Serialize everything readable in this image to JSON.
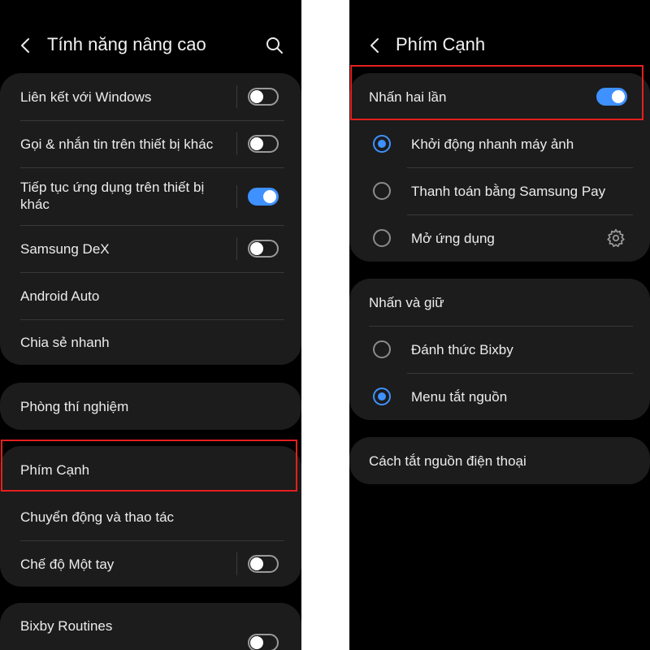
{
  "left": {
    "title": "Tính năng nâng cao",
    "group1": [
      {
        "label": "Liên kết với Windows",
        "toggle": "off"
      },
      {
        "label": "Gọi & nhắn tin trên thiết bị khác",
        "toggle": "off"
      },
      {
        "label": "Tiếp tục ứng dụng trên thiết bị khác",
        "toggle": "on"
      },
      {
        "label": "Samsung DeX",
        "toggle": "off"
      },
      {
        "label": "Android Auto"
      },
      {
        "label": "Chia sẻ nhanh"
      }
    ],
    "labs_label": "Phòng thí nghiệm",
    "group3": [
      {
        "label": "Phím Cạnh"
      },
      {
        "label": "Chuyển động và thao tác"
      },
      {
        "label": "Chế độ Một tay",
        "toggle": "off"
      }
    ],
    "bixby_label": "Bixby Routines"
  },
  "right": {
    "title": "Phím Cạnh",
    "double_press": {
      "label": "Nhấn hai lần",
      "toggle": "on"
    },
    "double_press_options": [
      {
        "label": "Khởi động nhanh máy ảnh",
        "selected": true
      },
      {
        "label": "Thanh toán bằng Samsung Pay",
        "selected": false
      },
      {
        "label": "Mở ứng dụng",
        "selected": false
      }
    ],
    "press_hold_label": "Nhấn và giữ",
    "press_hold_options": [
      {
        "label": "Đánh thức Bixby",
        "selected": false
      },
      {
        "label": "Menu tắt nguồn",
        "selected": true
      }
    ],
    "power_off_label": "Cách tắt nguồn điện thoại"
  },
  "colors": {
    "accent": "#3e91ff",
    "highlight": "#e41f1f",
    "card": "#1c1c1c",
    "background": "#000000"
  }
}
